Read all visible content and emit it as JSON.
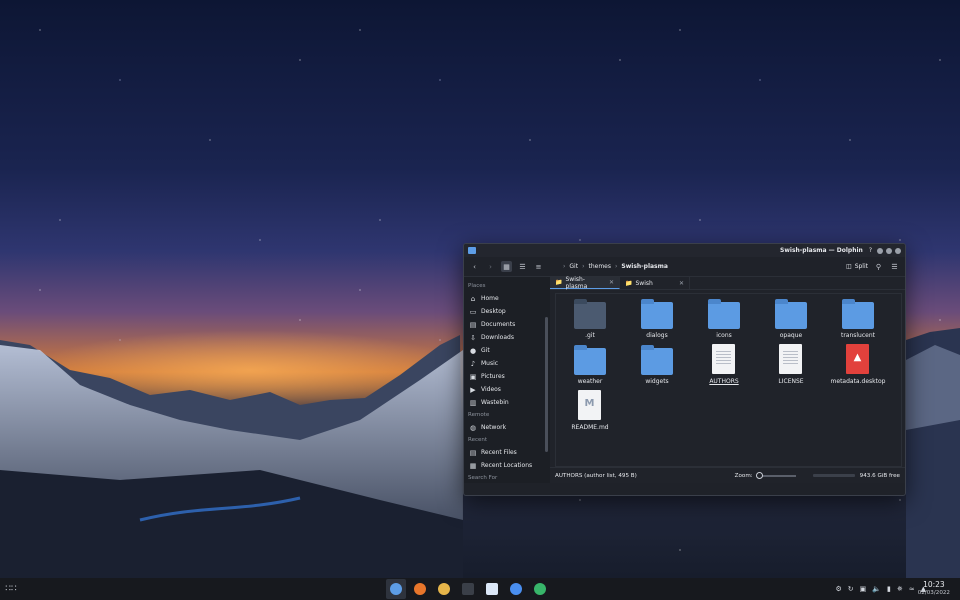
{
  "window": {
    "title": "Swish-plasma — Dolphin",
    "help_glyph": "?",
    "breadcrumbs": [
      "Git",
      "themes",
      "Swish-plasma"
    ],
    "split_label": "Split"
  },
  "sidebar": {
    "places_heading": "Places",
    "places": [
      {
        "label": "Home",
        "icon": "home-icon"
      },
      {
        "label": "Desktop",
        "icon": "desktop-icon"
      },
      {
        "label": "Documents",
        "icon": "documents-icon"
      },
      {
        "label": "Downloads",
        "icon": "downloads-icon"
      },
      {
        "label": "Git",
        "icon": "github-icon"
      },
      {
        "label": "Music",
        "icon": "music-icon"
      },
      {
        "label": "Pictures",
        "icon": "pictures-icon"
      },
      {
        "label": "Videos",
        "icon": "videos-icon"
      },
      {
        "label": "Wastebin",
        "icon": "wastebin-icon"
      }
    ],
    "remote_heading": "Remote",
    "remote": [
      {
        "label": "Network",
        "icon": "network-icon"
      }
    ],
    "recent_heading": "Recent",
    "recent": [
      {
        "label": "Recent Files",
        "icon": "recent-files-icon"
      },
      {
        "label": "Recent Locations",
        "icon": "recent-locations-icon"
      }
    ],
    "search_heading": "Search For"
  },
  "tabs": [
    {
      "label": "Swish-plasma",
      "active": true
    },
    {
      "label": "Swish",
      "active": false
    }
  ],
  "files": [
    {
      "name": ".git",
      "kind": "folder-dark"
    },
    {
      "name": "dialogs",
      "kind": "folder"
    },
    {
      "name": "icons",
      "kind": "folder"
    },
    {
      "name": "opaque",
      "kind": "folder"
    },
    {
      "name": "translucent",
      "kind": "folder"
    },
    {
      "name": "weather",
      "kind": "folder"
    },
    {
      "name": "widgets",
      "kind": "folder"
    },
    {
      "name": "AUTHORS",
      "kind": "doc",
      "selected": true
    },
    {
      "name": "LICENSE",
      "kind": "doc"
    },
    {
      "name": "metadata.desktop",
      "kind": "doc-red"
    },
    {
      "name": "README.md",
      "kind": "doc-md"
    }
  ],
  "status": {
    "selection_text": "AUTHORS (author list, 495 B)",
    "zoom_label": "Zoom:",
    "free_space": "943.6 GiB free"
  },
  "taskbar": {
    "apps": [
      {
        "name": "dolphin-icon",
        "color": "#5d9de6",
        "active": true
      },
      {
        "name": "firefox-icon",
        "color": "#e8762b"
      },
      {
        "name": "slack-icon",
        "color": "#e6b54a"
      },
      {
        "name": "terminal-icon",
        "color": "#3a3f48"
      },
      {
        "name": "text-editor-icon",
        "color": "#dce8f8"
      },
      {
        "name": "chrome-icon",
        "color": "#4a8ff0"
      },
      {
        "name": "updater-icon",
        "color": "#38b56a"
      }
    ],
    "time": "10:23",
    "date": "02/03/2022"
  },
  "colors": {
    "accent": "#5d9de6",
    "window_bg": "#1f2229",
    "taskbar_bg": "#17191e"
  }
}
